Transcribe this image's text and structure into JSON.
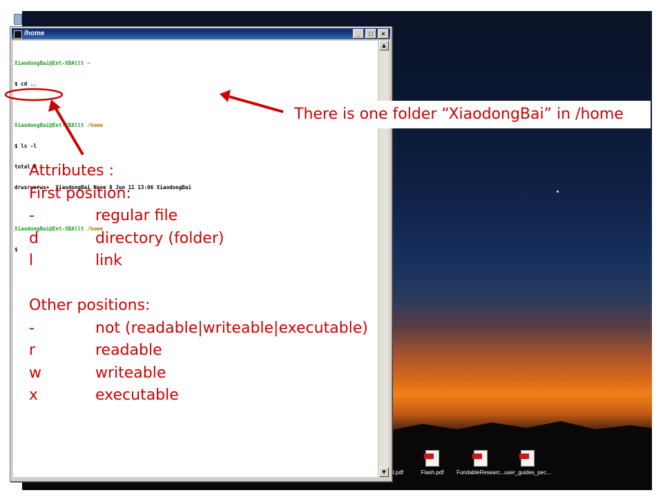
{
  "window": {
    "title": "/home",
    "buttons": [
      "_",
      "□",
      "×"
    ]
  },
  "terminal": {
    "lines": [
      {
        "user": "XiaodongBai@Ent-XBAllt",
        "path": "~"
      },
      {
        "cmd": "$ cd .."
      },
      {
        "blank": true
      },
      {
        "user": "XiaodongBai@Ent-XBAllt",
        "path": "/home"
      },
      {
        "cmd": "$ ls -l"
      },
      {
        "cmd": "total 0"
      },
      {
        "cmd": "drwxrwxrwx+  XiaodongBai None 0 Jun 11 13:06 XiaodongBai"
      },
      {
        "blank": true
      },
      {
        "user": "XiaodongBai@Ent-XBAllt",
        "path": "/home"
      },
      {
        "cmd": "$"
      }
    ]
  },
  "callout": "There is one folder “XiaodongBai” in /home",
  "annotation": {
    "title": "Attributes :",
    "first_heading": "First position:",
    "first_items": [
      {
        "symbol": "-",
        "text": "regular file"
      },
      {
        "symbol": "d",
        "text": "directory (folder)"
      },
      {
        "symbol": "l",
        "text": "link"
      }
    ],
    "other_heading": "Other positions:",
    "other_items": [
      {
        "symbol": "-",
        "text": "not (readable|writeable|executable)"
      },
      {
        "symbol": "r",
        "text": "readable"
      },
      {
        "symbol": "w",
        "text": "writeable"
      },
      {
        "symbol": "x",
        "text": "executable"
      }
    ]
  },
  "desktop_icons": [
    {
      "label": "ual.pdf",
      "icon": "pdf-icon"
    },
    {
      "label": "Flash.pdf",
      "icon": "pdf-icon"
    },
    {
      "label": "FundableResearc...",
      "icon": "pdf-icon"
    },
    {
      "label": "user_guides_pec...",
      "icon": "pdf-icon"
    }
  ],
  "colors": {
    "annotation": "#cc0000",
    "titlebar": "#0a246a",
    "prompt_user": "#1b9a2b",
    "prompt_path": "#a07a00"
  }
}
